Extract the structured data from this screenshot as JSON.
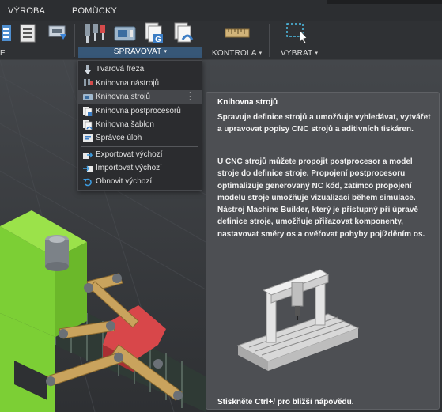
{
  "tabs": [
    {
      "label": "VÝROBA"
    },
    {
      "label": "POMŮCKY"
    }
  ],
  "ribbon": {
    "groups": [
      {
        "label": "E"
      },
      {
        "label": "SPRAVOVAT",
        "caret": "▾"
      },
      {
        "label": "KONTROLA",
        "caret": "▾"
      },
      {
        "label": "VYBRAT",
        "caret": "▾"
      }
    ],
    "buttons": [
      {
        "icon": "ncprogram-icon"
      },
      {
        "icon": "setup-sheet-icon"
      },
      {
        "icon": "post-icon"
      },
      {
        "icon": "milling-tool-icon"
      },
      {
        "icon": "machine-icon"
      },
      {
        "icon": "template-g-icon"
      },
      {
        "icon": "template-s-icon"
      },
      {
        "icon": "ruler-icon"
      },
      {
        "icon": "select-cursor-icon"
      }
    ]
  },
  "menu": {
    "items": [
      {
        "label": "Tvarová fréza",
        "icon": "form-mill-icon"
      },
      {
        "label": "Knihovna nástrojů",
        "icon": "tool-library-icon"
      },
      {
        "label": "Knihovna strojů",
        "icon": "machine-library-icon",
        "highlighted": true,
        "more": "⋮"
      },
      {
        "label": "Knihovna postprocesorů",
        "icon": "post-library-icon"
      },
      {
        "label": "Knihovna šablon",
        "icon": "template-library-icon"
      },
      {
        "label": "Správce úloh",
        "icon": "task-manager-icon"
      },
      {
        "label": "Exportovat výchozí",
        "icon": "export-icon"
      },
      {
        "label": "Importovat výchozí",
        "icon": "import-icon"
      },
      {
        "label": "Obnovit výchozí",
        "icon": "restore-icon"
      }
    ]
  },
  "tooltip": {
    "title": "Knihovna strojů",
    "para1": "Spravuje definice strojů a umožňuje vyhledávat, vytvářet a upravovat popisy CNC strojů a aditivních tiskáren.",
    "para2": "U CNC strojů můžete propojit postprocesor a model stroje do definice stroje. Propojení postprocesoru optimalizuje generovaný NC kód, zatímco propojení modelu stroje umožňuje vizualizaci během simulace. Nástroj Machine Builder, který je přístupný při úpravě definice stroje, umožňuje přiřazovat komponenty, nastavovat směry os a ověřovat pohyby pojížděním os.",
    "footer": "Stiskněte Ctrl+/ pro bližší nápovědu."
  },
  "colors": {
    "accent": "#375777",
    "tooltip_bg": "#4d4f53",
    "model_green": "#7ccf35",
    "model_red": "#d8474a",
    "model_tan": "#c9a35d"
  }
}
